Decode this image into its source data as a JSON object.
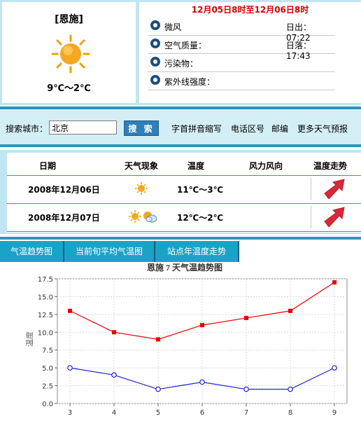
{
  "today": {
    "city": "[恩施]",
    "temp_range": "9℃～2℃",
    "weather_icon": "sun-icon"
  },
  "details": {
    "date_range": "12月05日8时至12月06日8时",
    "wind": "微风",
    "sunrise_label": "日出：07:22",
    "air_quality_label": "空气质量：",
    "sunset_label": "日落：17:43",
    "pollutant_label": "污染物：",
    "uv_label": "紫外线强度："
  },
  "search": {
    "label": "搜索城市：",
    "value": "北京",
    "button": "搜 索",
    "links": [
      "字首拼音缩写",
      "电话区号",
      "邮编",
      "更多天气预报"
    ]
  },
  "forecast": {
    "headers": [
      "日期",
      "天气现象",
      "温度",
      "风力风向",
      "温度走势"
    ],
    "rows": [
      {
        "date": "2008年12月06日",
        "temp": "11℃～3℃",
        "icons": [
          "sun-icon"
        ]
      },
      {
        "date": "2008年12月07日",
        "temp": "12℃～2℃",
        "icons": [
          "sun-icon",
          "partly-cloudy-icon"
        ]
      }
    ],
    "trend_icon": "trend-up-arrow-icon"
  },
  "tabs": [
    "气温趋势图",
    "当前旬平均气温图",
    "站点年温度走势"
  ],
  "chart_data": {
    "type": "line",
    "title": "恩施 7 天气温趋势图",
    "ylabel": "温度",
    "xlabel": "",
    "x": [
      3,
      4,
      5,
      6,
      7,
      8,
      9
    ],
    "ylim": [
      0,
      17.5
    ],
    "yticks": [
      "0.0",
      "2.5",
      "5.0",
      "7.5",
      "10.0",
      "12.5",
      "15.0",
      "17.5"
    ],
    "grid": true,
    "series": [
      {
        "values": [
          13,
          10,
          9,
          11,
          12,
          13,
          17
        ],
        "color": "#ee0000",
        "marker": "square"
      },
      {
        "values": [
          5,
          4,
          2,
          3,
          2,
          2,
          5
        ],
        "color": "#2222cc",
        "marker": "circle"
      }
    ]
  },
  "colors": {
    "accent": "#2a95c0",
    "date_red": "#d40000",
    "tab_bg": "#1ba3c7"
  }
}
